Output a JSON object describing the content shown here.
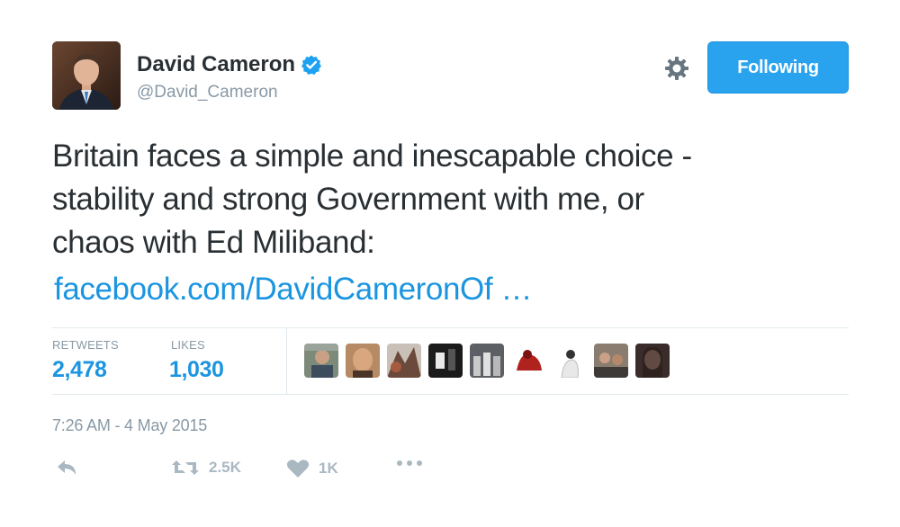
{
  "author": {
    "name": "David Cameron",
    "handle": "@David_Cameron",
    "verified": true,
    "avatar_icon": "profile-photo"
  },
  "header": {
    "settings_icon": "gear-icon",
    "follow_button_label": "Following"
  },
  "tweet": {
    "text_lines": [
      "Britain faces a simple and inescapable choice -",
      "stability and strong Government with me, or",
      "chaos with Ed Miliband:"
    ],
    "link_text": "facebook.com/DavidCameronOf …"
  },
  "stats": {
    "retweets_label": "RETWEETS",
    "retweets_value": "2,478",
    "likes_label": "LIKES",
    "likes_value": "1,030"
  },
  "timestamp": "7:26 AM - 4 May 2015",
  "actions": {
    "reply_icon": "reply-icon",
    "retweet_icon": "retweet-icon",
    "retweet_count": "2.5K",
    "like_icon": "heart-icon",
    "like_count": "1K",
    "more_icon": "more-icon"
  },
  "colors": {
    "accent": "#1b95e0",
    "button": "#2aa3ef",
    "muted": "#8899a6",
    "text": "#292f33",
    "divider": "#e1e8ed"
  }
}
